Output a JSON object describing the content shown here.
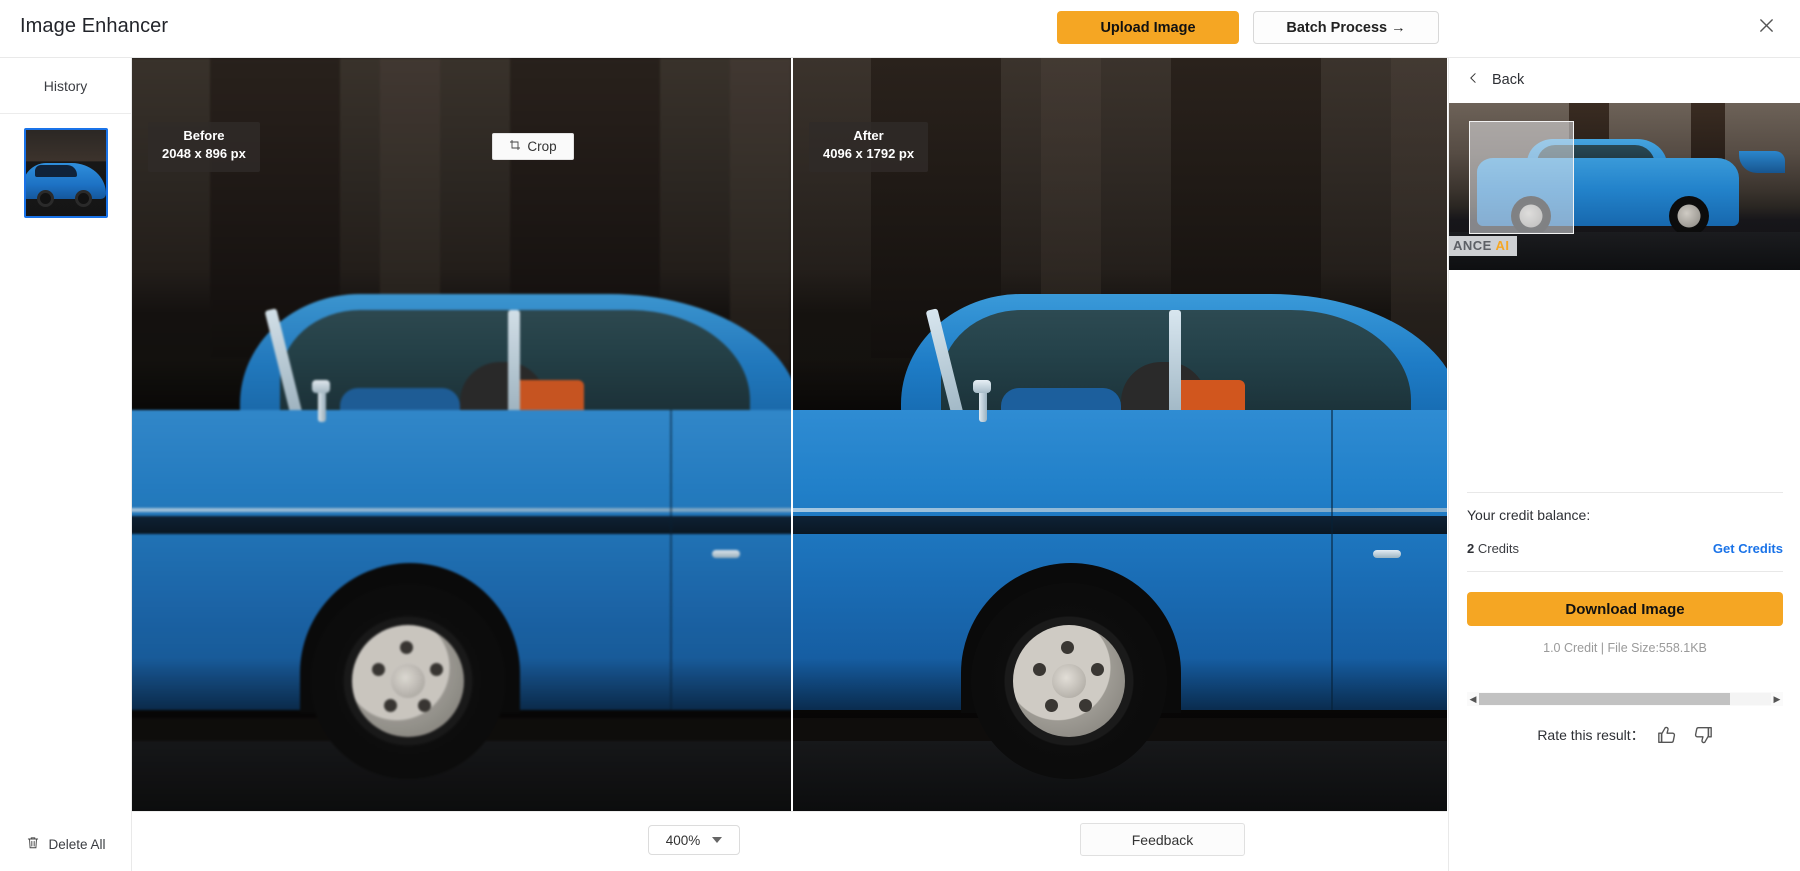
{
  "header": {
    "title": "Image Enhancer",
    "upload_label": "Upload Image",
    "batch_label": "Batch Process →",
    "close_icon": "close-icon"
  },
  "sidebar": {
    "history_label": "History",
    "delete_all_label": "Delete All",
    "delete_icon": "trash-icon",
    "items": [
      {
        "name": "history-thumbnail-1",
        "selected": true
      }
    ]
  },
  "canvas": {
    "before": {
      "title": "Before",
      "dimensions": "2048 x 896 px"
    },
    "after": {
      "title": "After",
      "dimensions": "4096 x 1792 px"
    },
    "crop_label": "Crop",
    "crop_icon": "crop-icon"
  },
  "bottom_bar": {
    "zoom_value": "400%",
    "zoom_chevron_icon": "chevron-down-icon",
    "feedback_label": "Feedback"
  },
  "right_panel": {
    "back_label": "Back",
    "back_icon": "chevron-left-icon",
    "watermark": "ANCE AI",
    "watermark_accent": "AI",
    "credit_balance_title": "Your credit balance:",
    "credit_amount": "2",
    "credit_unit": "Credits",
    "get_credits_label": "Get Credits",
    "download_label": "Download Image",
    "download_meta": "1.0 Credit | File Size:558.1KB",
    "rate_label": "Rate this result：",
    "thumbs_up_icon": "thumbs-up-icon",
    "thumbs_down_icon": "thumbs-down-icon",
    "scroll_left_icon": "scroll-left-arrow-icon",
    "scroll_right_icon": "scroll-right-arrow-icon"
  },
  "colors": {
    "accent_orange": "#f5a623",
    "link_blue": "#1a73e8",
    "selection_blue": "#1a73e8",
    "canvas_bg": "#100f0f"
  }
}
